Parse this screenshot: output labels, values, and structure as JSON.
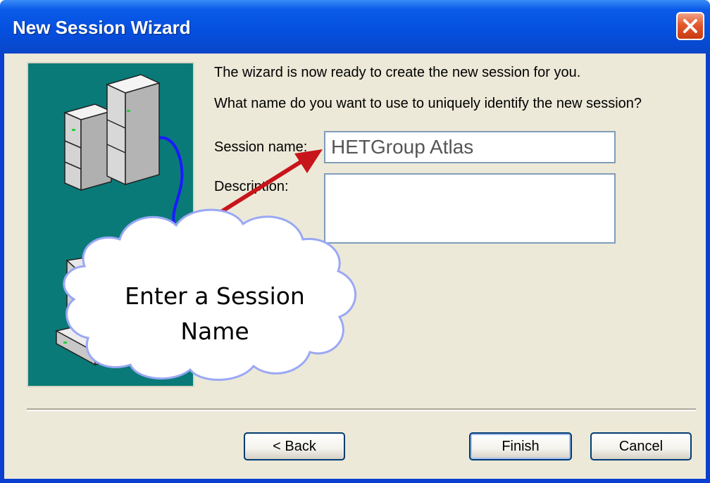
{
  "window": {
    "title": "New Session Wizard",
    "close_icon": "close-icon"
  },
  "wizard": {
    "intro_text": "The wizard is now ready to create the new session for you.",
    "question_text": "What name do you want to use to uniquely identify the new session?",
    "session_name_label": "Session name:",
    "session_name_value": "HETGroup Atlas",
    "description_label": "Description:",
    "description_value": ""
  },
  "buttons": {
    "back": "< Back",
    "finish": "Finish",
    "cancel": "Cancel"
  },
  "annotation": {
    "line1": "Enter a Session",
    "line2": "Name",
    "arrow_color": "#c8141b",
    "cloud_border_color": "#9aa8f5"
  },
  "illustration": {
    "name": "servers-connected-to-computer",
    "background_color": "#0a7a78",
    "cable_color": "#1a1aff"
  }
}
